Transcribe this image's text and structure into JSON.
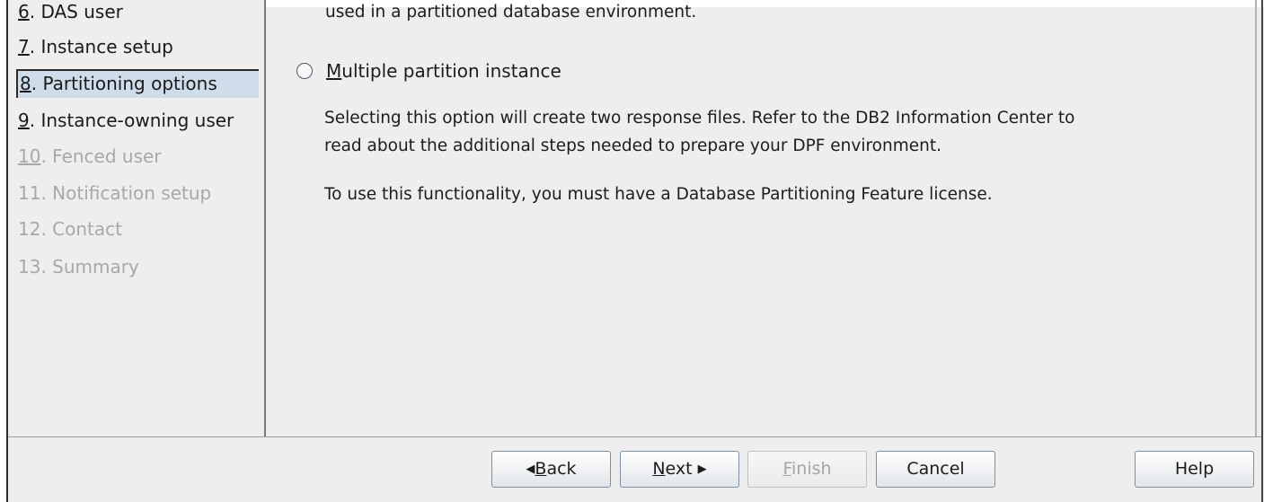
{
  "sidebar": {
    "items": [
      {
        "num": "6",
        "rest": ". DAS user",
        "state": "normal"
      },
      {
        "num": "7",
        "rest": ". Instance setup",
        "state": "normal"
      },
      {
        "num": "8",
        "rest": ". Partitioning options",
        "state": "selected"
      },
      {
        "num": "9",
        "rest": ". Instance-owning user",
        "state": "normal"
      },
      {
        "num": "10",
        "rest": ". Fenced user",
        "state": "disabled"
      },
      {
        "num": "11",
        "rest": ". Notification setup",
        "state": "disabled"
      },
      {
        "num": "12",
        "rest": ". Contact",
        "state": "disabled"
      },
      {
        "num": "13",
        "rest": ". Summary",
        "state": "disabled"
      }
    ]
  },
  "main": {
    "partial_line": "used in a partitioned database environment.",
    "radio": {
      "mnemonic": "M",
      "label_rest": "ultiple partition instance",
      "checked": false
    },
    "desc_line1": "Selecting this option will create two response files. Refer to the DB2 Information Center to",
    "desc_line2": "read about the additional steps needed to prepare your DPF environment.",
    "license_line": "To use this functionality, you must have a Database Partitioning Feature license."
  },
  "buttons": {
    "back": {
      "mnemonic": "B",
      "rest": "ack",
      "arrow": "◀"
    },
    "next": {
      "mnemonic": "N",
      "rest": "ext",
      "arrow": "▶"
    },
    "finish": {
      "mnemonic": "F",
      "rest": "inish"
    },
    "cancel": "Cancel",
    "help": "Help"
  }
}
